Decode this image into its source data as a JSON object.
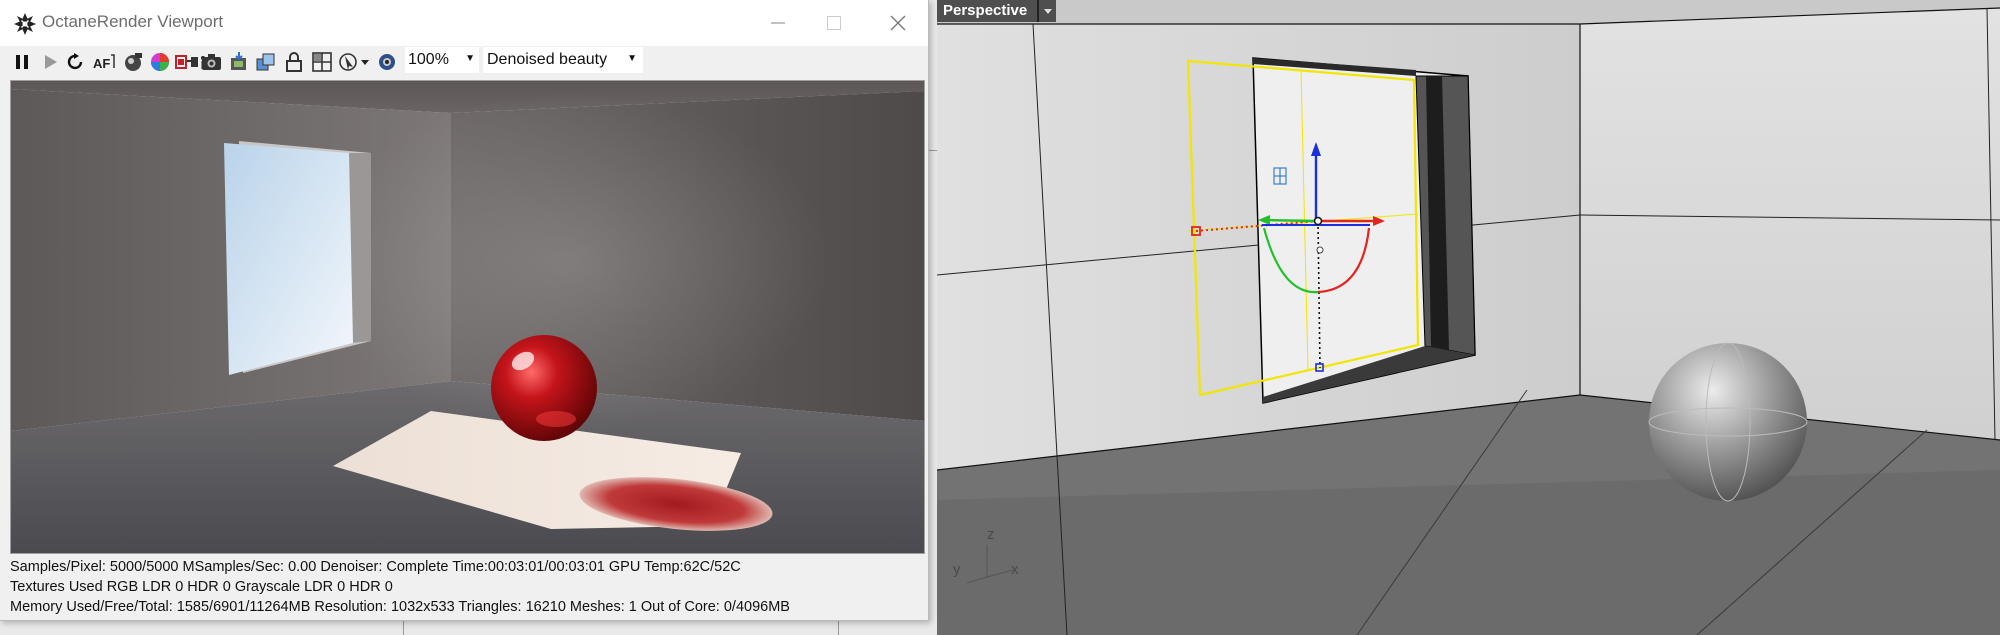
{
  "window": {
    "title": "OctaneRender Viewport"
  },
  "toolbar": {
    "icons": [
      "pause-icon",
      "play-icon",
      "restart-icon",
      "af-focus-icon",
      "sphere-camera-icon",
      "color-wheel-icon",
      "film-region-icon",
      "info-icon",
      "camera-icon",
      "save-image-icon",
      "layer-icon",
      "lock-icon",
      "grid-icon",
      "pick-icon",
      "dropdown-icon",
      "settings-eye-icon"
    ],
    "zoom": "100%",
    "render_pass": "Denoised beauty"
  },
  "status": {
    "line1": "Samples/Pixel: 5000/5000  MSamples/Sec: 0.00  Denoiser: Complete  Time:00:03:01/00:03:01  GPU Temp:62C/52C",
    "line2": "Textures Used RGB LDR 0  HDR 0  Grayscale LDR 0  HDR 0",
    "line3": "Memory Used/Free/Total: 1585/6901/11264MB  Resolution: 1032x533  Triangles: 16210  Meshes: 1 Out of Core: 0/4096MB"
  },
  "viewport": {
    "label": "Perspective",
    "axis_z": "z",
    "axis_y": "y",
    "axis_x": "x"
  },
  "colors": {
    "selection": "#f2e600",
    "gumball_x": "#e0261e",
    "gumball_y": "#22c02a",
    "gumball_z": "#1a2fe0",
    "sphere_red": "#c10f10"
  }
}
